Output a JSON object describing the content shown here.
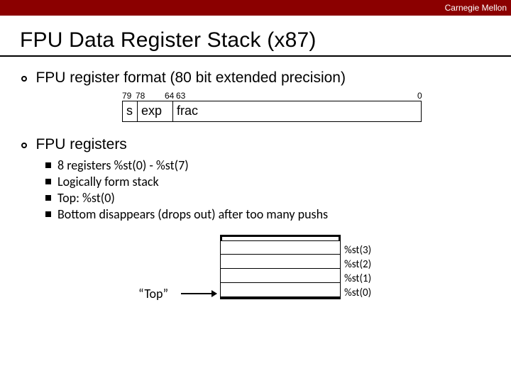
{
  "header": {
    "org": "Carnegie Mellon"
  },
  "title": "FPU Data Register Stack (x87)",
  "section1": {
    "heading": "FPU register format (80 bit extended precision)",
    "bits": {
      "msb": "79",
      "exp_hi": "78",
      "exp_lo": "64",
      "frac_hi": "63",
      "lsb": "0"
    },
    "fields": {
      "s": "s",
      "exp": "exp",
      "frac": "frac"
    }
  },
  "section2": {
    "heading": "FPU registers",
    "bullets": [
      "8 registers %st(0) - %st(7)",
      "Logically form stack",
      "Top: %st(0)",
      "Bottom disappears (drops out) after too many pushs"
    ]
  },
  "stack": {
    "top_label": "“Top”",
    "labels": [
      "%st(3)",
      "%st(2)",
      "%st(1)",
      "%st(0)"
    ]
  }
}
